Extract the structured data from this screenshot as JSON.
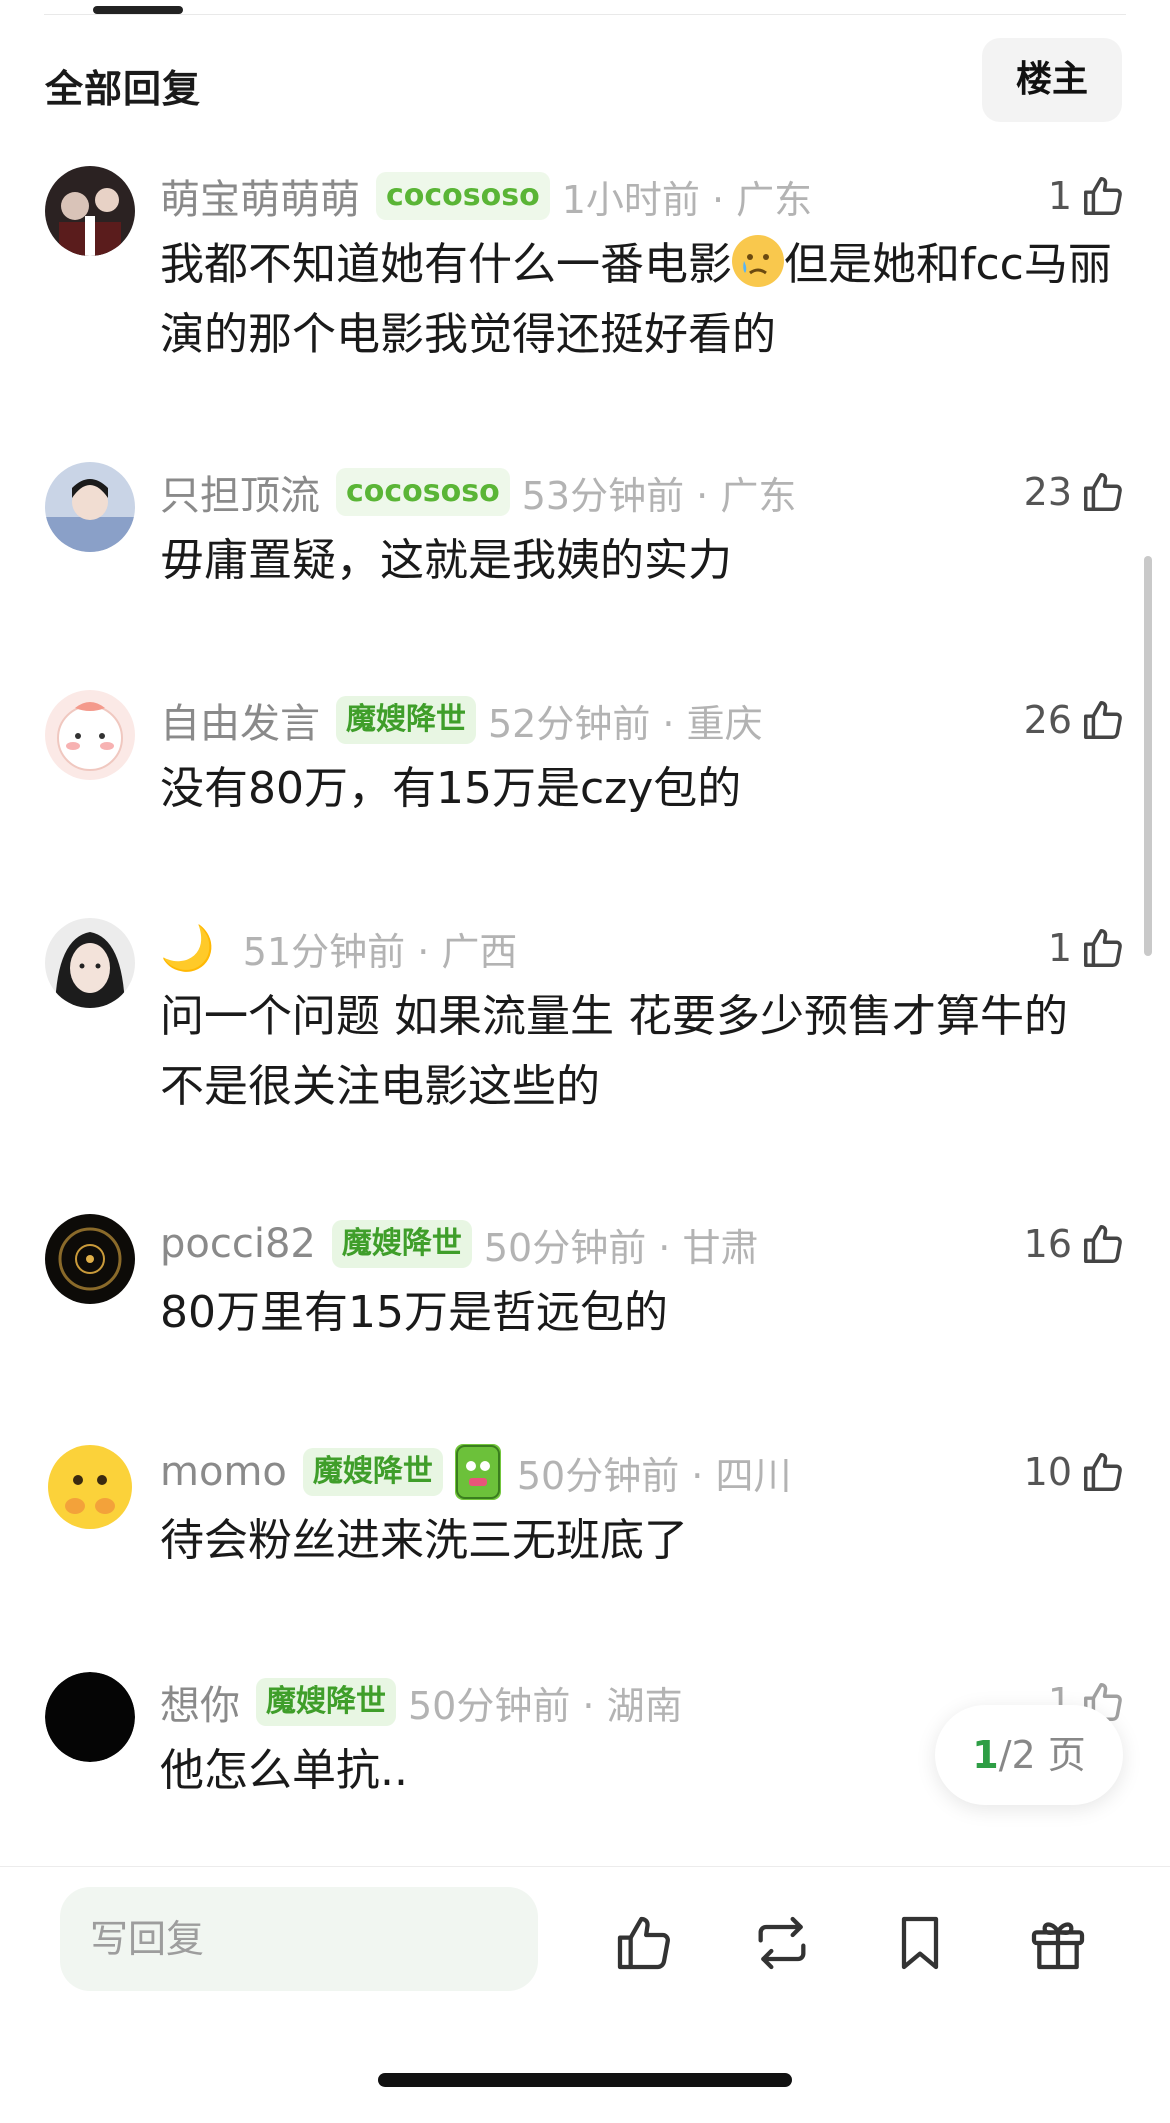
{
  "header": {
    "title": "全部回复",
    "author_button": "楼主"
  },
  "comments": [
    {
      "username": "萌宝萌萌萌",
      "badge": "cocososo",
      "badge_type": "cocososo",
      "time": "1小时前 · 广东",
      "likes": "1",
      "text_part1": "我都不知道她有什么一番电影",
      "text_part2": "但是她和fcc马丽演的那个电影我觉得还挺好看的",
      "emoji": "cry-face"
    },
    {
      "username": "只担顶流",
      "badge": "cocososo",
      "badge_type": "cocososo",
      "time": "53分钟前 · 广东",
      "likes": "23",
      "text": "毋庸置疑，这就是我姨的实力"
    },
    {
      "username": "自由发言",
      "badge": "魔嫂降世",
      "badge_type": "mosao",
      "time": "52分钟前 · 重庆",
      "likes": "26",
      "text": "没有80万，有15万是czy包的"
    },
    {
      "username": "",
      "user_icon": "moon",
      "moon_glyph": "🌙",
      "time": "51分钟前 · 广西",
      "likes": "1",
      "text": "问一个问题 如果流量生 花要多少预售才算牛的 不是很关注电影这些的"
    },
    {
      "username": "pocci82",
      "badge": "魔嫂降世",
      "badge_type": "mosao",
      "time": "50分钟前 · 甘肃",
      "likes": "16",
      "text": "80万里有15万是哲远包的"
    },
    {
      "username": "momo",
      "badge": "魔嫂降世",
      "badge_type": "mosao",
      "sticker": "green-sticker",
      "time": "50分钟前 · 四川",
      "likes": "10",
      "text": "待会粉丝进来洗三无班底了"
    },
    {
      "username": "想你",
      "badge": "魔嫂降世",
      "badge_type": "mosao",
      "time": "50分钟前 · 湖南",
      "likes": "1",
      "text": "他怎么单抗.."
    }
  ],
  "pagination": {
    "current": "1",
    "separator_total": "/2 页"
  },
  "bottom_bar": {
    "reply_placeholder": "写回复",
    "actions": [
      "like-icon",
      "repost-icon",
      "bookmark-icon",
      "gift-icon"
    ]
  },
  "colors": {
    "badge_green": "#3f9e2a",
    "page_current": "#2e9e45",
    "muted": "#b3b3b3"
  }
}
